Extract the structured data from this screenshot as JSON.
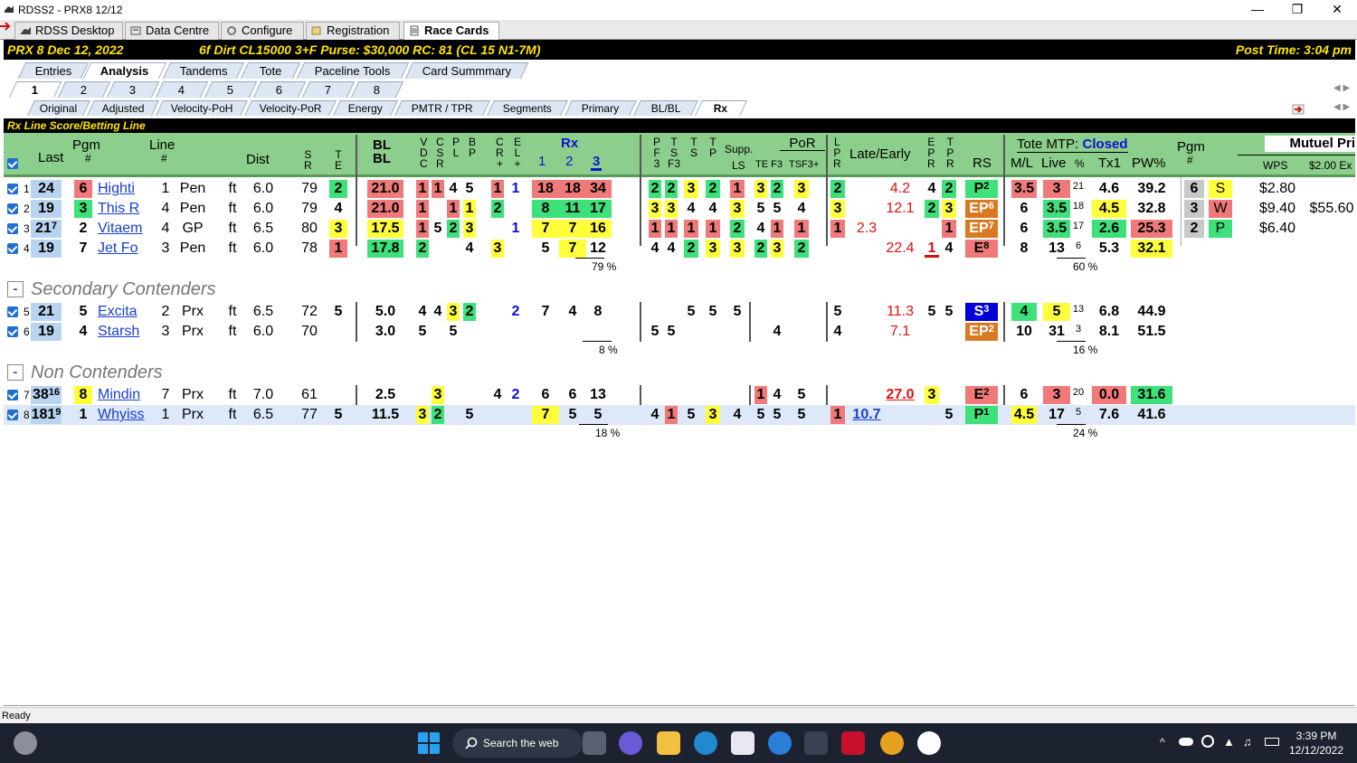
{
  "window": {
    "title": "RDSS2 - PRX8  12/12"
  },
  "app_tabs": [
    "RDSS Desktop",
    "Data Centre",
    "Configure",
    "Registration",
    "Race Cards"
  ],
  "race": {
    "header": "PRX  8   Dec 12, 2022",
    "conditions": "6f  Dirt   CL15000  3+F   Purse: $30,000   RC: 81  (CL 15 N1-7M)",
    "post_time": "Post Time: 3:04 pm"
  },
  "sub_tabs": [
    "Entries",
    "Analysis",
    "Tandems",
    "Tote",
    "Paceline Tools",
    "Card Summmary"
  ],
  "race_tabs": [
    "1",
    "2",
    "3",
    "4",
    "5",
    "6",
    "7",
    "8"
  ],
  "view_tabs": [
    "Original",
    "Adjusted",
    "Velocity-PoH",
    "Velocity-PoR",
    "Energy",
    "PMTR / TPR",
    "Segments",
    "Primary",
    "BL/BL",
    "Rx"
  ],
  "section_title": "Rx Line Score/Betting Line",
  "headers": {
    "last": "Last",
    "pgm": "Pgm",
    "pgm_hash": "#",
    "line": "Line",
    "line_hash": "#",
    "dist": "Dist",
    "sr": "S\nR",
    "te": "T\nE",
    "blbl": "BL\nBL",
    "vdc": "V\nD\nC",
    "csr": "C\nS\nR",
    "pl": "P\nL",
    "bp": "B\nP",
    "cr": "C\nR\n+",
    "el": "E\nL\n+",
    "rx": "Rx",
    "rx1": "1",
    "rx2": "2",
    "rx3": "3",
    "pf3": "P\nF\n3",
    "tsf3": "T\nS\nF3",
    "ts": "T\nS",
    "tp": "T\nP",
    "supp": "Supp.",
    "ls": "LS",
    "por": "PoR",
    "te_f3": "TE F3",
    "tsf3p": "TSF3+",
    "lpr": "L\nP\nR",
    "late_early": "Late/Early",
    "epr": "E\nP\nR",
    "tpr": "T\nP\nR",
    "rs": "RS",
    "tote_mtp": "Tote MTP:",
    "tote_status": "Closed",
    "ml": "M/L",
    "live": "Live",
    "pct": "%",
    "tx1": "Tx1",
    "pw": "PW%",
    "pgm2": "Pgm",
    "pgm2_hash": "#",
    "mutuel": "Mutuel Pri",
    "wps": "WPS",
    "ex": "$2.00 Ex"
  },
  "groups": {
    "secondary": "Secondary Contenders",
    "non": "Non Contenders"
  },
  "rows": [
    {
      "n": "1",
      "last": "24",
      "pgm": "6",
      "name": "Highti",
      "line": "1",
      "trk": "Pen",
      "surf": "ft",
      "dist": "6.0",
      "sr": "79",
      "te": "2",
      "bl": "21.0",
      "vdc": "1",
      "csr": "1",
      "pl": "4",
      "bp": "5",
      "cr": "1",
      "el": "1",
      "rx1": "18",
      "rx2": "18",
      "rx3": "34",
      "pf3": "2",
      "tsf3": "2",
      "ts": "3",
      "tp": "2",
      "ls": "1",
      "te2": "3",
      "f3": "2",
      "tsf3p": "3",
      "lpr": "2",
      "le1": "",
      "le2": "4.2",
      "epr": "4",
      "tpr": "2",
      "rs": "P",
      "rs_s": "2",
      "ml": "3.5",
      "live": "3",
      "lp": "21",
      "tx1": "4.6",
      "pw": "39.2",
      "p2": "6",
      "wps": "S",
      "w1": "$2.80",
      "w2": ""
    },
    {
      "n": "2",
      "last": "19",
      "pgm": "3",
      "name": "This R",
      "line": "4",
      "trk": "Pen",
      "surf": "ft",
      "dist": "6.0",
      "sr": "79",
      "te": "4",
      "bl": "21.0",
      "vdc": "1",
      "csr": "",
      "pl": "1",
      "bp": "1",
      "cr": "2",
      "el": "",
      "rx1": "8",
      "rx2": "11",
      "rx3": "17",
      "pf3": "3",
      "tsf3": "3",
      "ts": "4",
      "tp": "4",
      "ls": "3",
      "te2": "5",
      "f3": "5",
      "tsf3p": "4",
      "lpr": "3",
      "le1": "",
      "le2": "12.1",
      "epr": "2",
      "tpr": "3",
      "rs": "EP",
      "rs_s": "6",
      "ml": "6",
      "live": "3.5",
      "lp": "18",
      "tx1": "4.5",
      "pw": "32.8",
      "p2": "3",
      "wps": "W",
      "w1": "$9.40",
      "w2": "$55.60"
    },
    {
      "n": "3",
      "last": "21",
      "last_s": "7",
      "pgm": "2",
      "name": "Vitaem",
      "line": "4",
      "trk": "GP",
      "surf": "ft",
      "dist": "6.5",
      "sr": "80",
      "te": "3",
      "bl": "17.5",
      "vdc": "1",
      "csr": "5",
      "pl": "2",
      "bp": "3",
      "cr": "",
      "el": "1",
      "rx1": "7",
      "rx2": "7",
      "rx3": "16",
      "pf3": "1",
      "tsf3": "1",
      "ts": "1",
      "tp": "1",
      "ls": "2",
      "te2": "4",
      "f3": "1",
      "tsf3p": "1",
      "lpr": "1",
      "le1": "2.3",
      "le2": "",
      "epr": "",
      "tpr": "1",
      "rs": "EP",
      "rs_s": "7",
      "ml": "6",
      "live": "3.5",
      "lp": "17",
      "tx1": "2.6",
      "pw": "25.3",
      "p2": "2",
      "wps": "P",
      "w1": "$6.40",
      "w2": ""
    },
    {
      "n": "4",
      "last": "19",
      "pgm": "7",
      "name": "Jet Fo",
      "line": "3",
      "trk": "Pen",
      "surf": "ft",
      "dist": "6.0",
      "sr": "78",
      "te": "1",
      "bl": "17.8",
      "vdc": "2",
      "csr": "",
      "pl": "",
      "bp": "4",
      "cr": "3",
      "el": "",
      "rx1": "5",
      "rx2": "7",
      "rx3": "12",
      "pf3": "4",
      "tsf3": "4",
      "ts": "2",
      "tp": "3",
      "ls": "3",
      "te2": "2",
      "f3": "3",
      "tsf3p": "2",
      "lpr": "",
      "le1": "",
      "le2": "22.4",
      "epr": "1",
      "tpr": "4",
      "rs": "E",
      "rs_s": "8",
      "ml": "8",
      "live": "13",
      "lp": "6",
      "tx1": "5.3",
      "pw": "32.1",
      "p2": "",
      "wps": "",
      "w1": "",
      "w2": ""
    },
    {
      "n": "5",
      "last": "21",
      "pgm": "5",
      "name": "Excita",
      "line": "2",
      "trk": "Prx",
      "surf": "ft",
      "dist": "6.5",
      "sr": "72",
      "te": "5",
      "bl": "5.0",
      "vdc": "4",
      "csr": "4",
      "pl": "3",
      "bp": "2",
      "cr": "",
      "el": "2",
      "rx1": "7",
      "rx2": "4",
      "rx3": "8",
      "pf3": "",
      "tsf3": "",
      "ts": "5",
      "tp": "5",
      "ls": "5",
      "te2": "",
      "f3": "",
      "tsf3p": "",
      "lpr": "5",
      "le1": "",
      "le2": "11.3",
      "epr": "5",
      "tpr": "5",
      "rs": "S",
      "rs_s": "3",
      "ml": "4",
      "live": "5",
      "lp": "13",
      "tx1": "6.8",
      "pw": "44.9",
      "p2": "",
      "wps": "",
      "w1": "",
      "w2": ""
    },
    {
      "n": "6",
      "last": "19",
      "pgm": "4",
      "name": "Starsh",
      "line": "3",
      "trk": "Prx",
      "surf": "ft",
      "dist": "6.0",
      "sr": "70",
      "te": "",
      "bl": "3.0",
      "vdc": "5",
      "csr": "",
      "pl": "5",
      "bp": "",
      "cr": "",
      "el": "",
      "rx1": "",
      "rx2": "",
      "rx3": "",
      "pf3": "5",
      "tsf3": "5",
      "ts": "",
      "tp": "",
      "ls": "",
      "te2": "",
      "f3": "4",
      "tsf3p": "",
      "lpr": "4",
      "le1": "",
      "le2": "7.1",
      "epr": "",
      "tpr": "",
      "rs": "EP",
      "rs_s": "2",
      "ml": "10",
      "live": "31",
      "lp": "3",
      "tx1": "8.1",
      "pw": "51.5",
      "p2": "",
      "wps": "",
      "w1": "",
      "w2": ""
    },
    {
      "n": "7",
      "last": "38",
      "last_s": "16",
      "pgm": "8",
      "name": "Mindin",
      "line": "7",
      "trk": "Prx",
      "surf": "ft",
      "dist": "7.0",
      "sr": "61",
      "te": "",
      "bl": "2.5",
      "vdc": "",
      "csr": "3",
      "pl": "",
      "bp": "",
      "cr": "4",
      "el": "2",
      "rx1": "6",
      "rx2": "6",
      "rx3": "13",
      "pf3": "",
      "tsf3": "",
      "ts": "",
      "tp": "",
      "ls": "",
      "te2": "1",
      "f3": "4",
      "tsf3p": "5",
      "lpr": "",
      "le1": "",
      "le2": "27.0",
      "epr": "3",
      "tpr": "",
      "rs": "E",
      "rs_s": "2",
      "ml": "6",
      "live": "3",
      "lp": "20",
      "tx1": "0.0",
      "pw": "31.6",
      "p2": "",
      "wps": "",
      "w1": "",
      "w2": ""
    },
    {
      "n": "8",
      "last": "181",
      "last_s": "9",
      "pgm": "1",
      "name": "Whyiss",
      "line": "1",
      "trk": "Prx",
      "surf": "ft",
      "dist": "6.5",
      "sr": "77",
      "te": "5",
      "bl": "11.5",
      "vdc": "3",
      "csr": "2",
      "pl": "",
      "bp": "5",
      "cr": "",
      "el": "",
      "rx1": "7",
      "rx2": "5",
      "rx3": "5",
      "pf3": "4",
      "tsf3": "1",
      "ts": "5",
      "tp": "3",
      "ls": "4",
      "te2": "5",
      "f3": "5",
      "tsf3p": "5",
      "lpr": "1",
      "le1": "10.7",
      "le2": "",
      "epr": "",
      "tpr": "5",
      "rs": "P",
      "rs_s": "1",
      "ml": "4.5",
      "live": "17",
      "lp": "5",
      "tx1": "7.6",
      "pw": "41.6",
      "p2": "",
      "wps": "",
      "w1": "",
      "w2": ""
    }
  ],
  "pct_rows": {
    "contenders_rx": "79 %",
    "contenders_tote": "60 %",
    "secondary_rx": "8 %",
    "secondary_tote": "16 %",
    "non_rx": "18 %",
    "non_tote": "24 %"
  },
  "status": "Ready",
  "taskbar": {
    "search": "Search the web",
    "time": "3:39 PM",
    "date": "12/12/2022"
  }
}
